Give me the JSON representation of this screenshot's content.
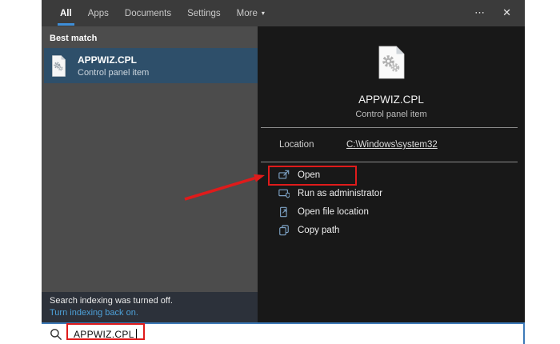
{
  "topbar": {
    "tabs": [
      {
        "label": "All",
        "active": true
      },
      {
        "label": "Apps",
        "active": false
      },
      {
        "label": "Documents",
        "active": false
      },
      {
        "label": "Settings",
        "active": false
      },
      {
        "label": "More",
        "active": false
      }
    ],
    "more_caret": "▾",
    "ellipsis_icon": "⋯",
    "close_icon": "✕"
  },
  "left_panel": {
    "section_header": "Best match",
    "best_match": {
      "title": "APPWIZ.CPL",
      "subtitle": "Control panel item",
      "icon": "cpl-file-icon"
    }
  },
  "detail_panel": {
    "title": "APPWIZ.CPL",
    "subtitle": "Control panel item",
    "icon": "cpl-file-icon",
    "location_label": "Location",
    "location_value": "C:\\Windows\\system32",
    "actions": [
      {
        "icon": "open-icon",
        "label": "Open"
      },
      {
        "icon": "run-as-administrator-icon",
        "label": "Run as administrator"
      },
      {
        "icon": "open-file-location-icon",
        "label": "Open file location"
      },
      {
        "icon": "copy-path-icon",
        "label": "Copy path"
      }
    ]
  },
  "footer": {
    "indexing_message": "Search indexing was turned off.",
    "indexing_link": "Turn indexing back on."
  },
  "search": {
    "icon": "search-icon",
    "value": "APPWIZ.CPL"
  },
  "colors": {
    "accent_blue": "#3e8ed8",
    "search_border": "#3d7ab8",
    "highlight": "#2e4f6a",
    "topbar": "#3b3b3b",
    "left_panel": "#4c4c4c",
    "right_panel": "#181818",
    "indexing_strip": "#2c313a",
    "link_blue": "#4da1d9",
    "annotation_red": "#df1b1b",
    "action_icon": "#7ea3c6"
  }
}
